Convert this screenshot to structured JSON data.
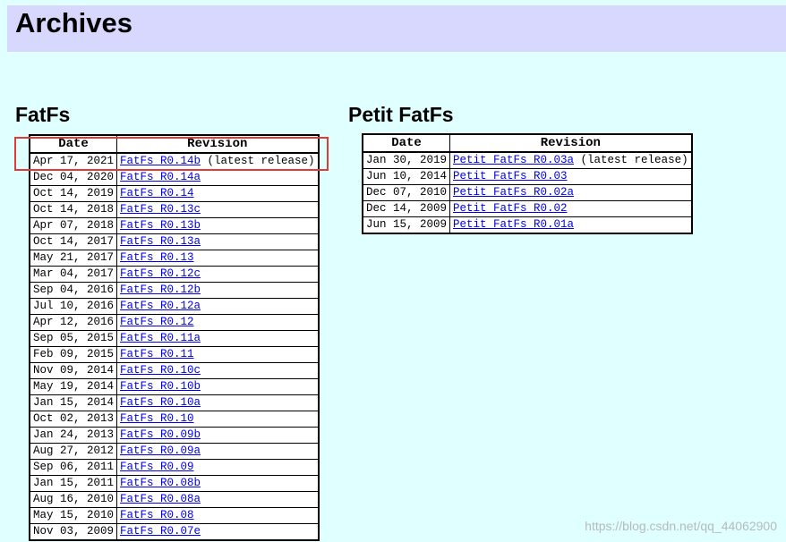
{
  "page": {
    "title": "Archives",
    "watermark": "https://blog.csdn.net/qq_44062900"
  },
  "colors": {
    "background": "#e0ffff",
    "header_band": "#d8d8ff",
    "link": "#0000ee",
    "highlight": "#e53935"
  },
  "fatfs": {
    "title": "FatFs",
    "headers": {
      "date": "Date",
      "revision": "Revision"
    },
    "rows": [
      {
        "date": "Apr 17, 2021",
        "link": "FatFs R0.14b",
        "note": " (latest release)"
      },
      {
        "date": "Dec 04, 2020",
        "link": "FatFs R0.14a",
        "note": ""
      },
      {
        "date": "Oct 14, 2019",
        "link": "FatFs R0.14",
        "note": ""
      },
      {
        "date": "Oct 14, 2018",
        "link": "FatFs R0.13c",
        "note": ""
      },
      {
        "date": "Apr 07, 2018",
        "link": "FatFs R0.13b",
        "note": ""
      },
      {
        "date": "Oct 14, 2017",
        "link": "FatFs R0.13a",
        "note": ""
      },
      {
        "date": "May 21, 2017",
        "link": "FatFs R0.13",
        "note": ""
      },
      {
        "date": "Mar 04, 2017",
        "link": "FatFs R0.12c",
        "note": ""
      },
      {
        "date": "Sep 04, 2016",
        "link": "FatFs R0.12b",
        "note": ""
      },
      {
        "date": "Jul 10, 2016",
        "link": "FatFs R0.12a",
        "note": ""
      },
      {
        "date": "Apr 12, 2016",
        "link": "FatFs R0.12",
        "note": ""
      },
      {
        "date": "Sep 05, 2015",
        "link": "FatFs R0.11a",
        "note": ""
      },
      {
        "date": "Feb 09, 2015",
        "link": "FatFs R0.11",
        "note": ""
      },
      {
        "date": "Nov 09, 2014",
        "link": "FatFs R0.10c",
        "note": ""
      },
      {
        "date": "May 19, 2014",
        "link": "FatFs R0.10b",
        "note": ""
      },
      {
        "date": "Jan 15, 2014",
        "link": "FatFs R0.10a",
        "note": ""
      },
      {
        "date": "Oct 02, 2013",
        "link": "FatFs R0.10",
        "note": ""
      },
      {
        "date": "Jan 24, 2013",
        "link": "FatFs R0.09b",
        "note": ""
      },
      {
        "date": "Aug 27, 2012",
        "link": "FatFs R0.09a",
        "note": ""
      },
      {
        "date": "Sep 06, 2011",
        "link": "FatFs R0.09",
        "note": ""
      },
      {
        "date": "Jan 15, 2011",
        "link": "FatFs R0.08b",
        "note": ""
      },
      {
        "date": "Aug 16, 2010",
        "link": "FatFs R0.08a",
        "note": ""
      },
      {
        "date": "May 15, 2010",
        "link": "FatFs R0.08",
        "note": ""
      },
      {
        "date": "Nov 03, 2009",
        "link": "FatFs R0.07e",
        "note": ""
      }
    ]
  },
  "petit": {
    "title": "Petit FatFs",
    "headers": {
      "date": "Date",
      "revision": "Revision"
    },
    "rows": [
      {
        "date": "Jan 30, 2019",
        "link": "Petit FatFs R0.03a",
        "note": " (latest release)"
      },
      {
        "date": "Jun 10, 2014",
        "link": "Petit FatFs R0.03",
        "note": ""
      },
      {
        "date": "Dec 07, 2010",
        "link": "Petit FatFs R0.02a",
        "note": ""
      },
      {
        "date": "Dec 14, 2009",
        "link": "Petit FatFs R0.02",
        "note": ""
      },
      {
        "date": "Jun 15, 2009",
        "link": "Petit FatFs R0.01a",
        "note": ""
      }
    ]
  }
}
